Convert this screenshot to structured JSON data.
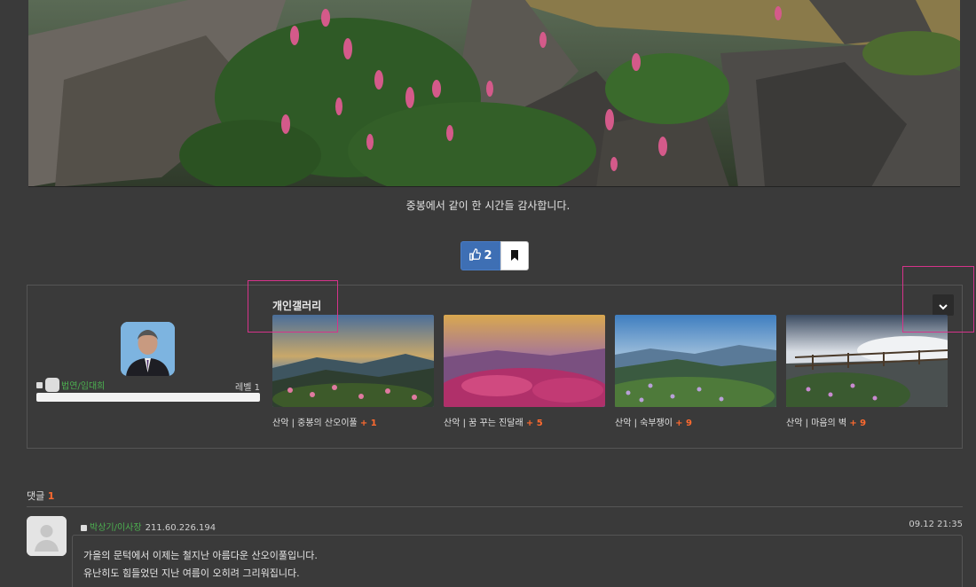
{
  "caption": "중봉에서 같이 한 시간들 감사합니다.",
  "actions": {
    "like_count": "2"
  },
  "author": {
    "name": "법연/임대희",
    "level": "레벨 1",
    "level_progress": 0.0
  },
  "gallery": {
    "title": "개인갤러리",
    "items": [
      {
        "category": "산악",
        "title": "중봉의 산오이풀",
        "count": "+ 1"
      },
      {
        "category": "산악",
        "title": "꿈 꾸는 진달래",
        "count": "+ 5"
      },
      {
        "category": "산악",
        "title": "숙부쟁이",
        "count": "+ 9"
      },
      {
        "category": "산악",
        "title": "마음의 벽",
        "count": "+ 9"
      }
    ]
  },
  "comments": {
    "label": "댓글",
    "count": "1",
    "items": [
      {
        "author": "박상기/이사장",
        "ip": "211.60.226.194",
        "time": "09.12 21:35",
        "line1": "가을의 문턱에서 이제는 철지난 아름다운 산오이풀입니다.",
        "line2": "유난히도 힘들었던 지난 여름이 오히려 그리워집니다."
      }
    ]
  }
}
